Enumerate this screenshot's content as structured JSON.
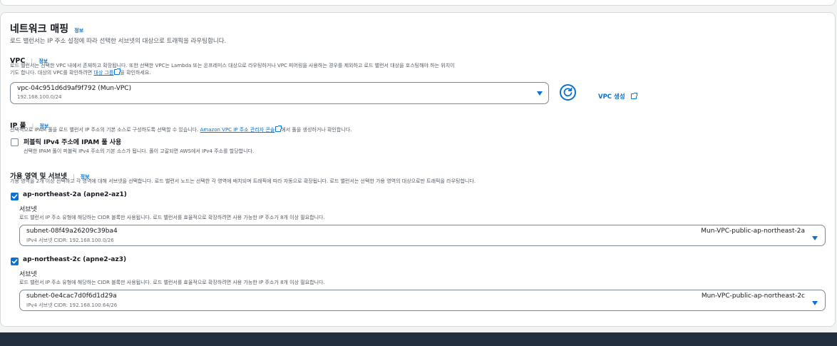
{
  "section": {
    "title": "네트워크 매핑",
    "info": "정보",
    "description": "로드 밸런서는 IP 주소 설정에 따라 선택한 서브넷의 대상으로 트래픽을 라우팅합니다."
  },
  "vpc": {
    "label": "VPC",
    "info": "정보",
    "desc_line1": "로드 밸런서는 선택한 VPC 내에서 존재하고 확장됩니다. 또한 선택한 VPC는 Lambda 또는 온프레미스 대상으로 라우팅하거나 VPC 피어링을 사용하는 경우를 제외하고 로드 밸런서 대상을 호스팅해야 하는 위치이",
    "desc_line2_pre": "기도 합니다. 대상의 VPC를 확인하려면",
    "desc_link": "대상 그룹",
    "desc_line2_post": "을 확인하세요.",
    "selected_id": "vpc-04c951d6d9af9f792 (Mun-VPC)",
    "selected_cidr": "192.168.100.0/24",
    "create_link": "VPC 생성"
  },
  "ip_pool": {
    "label": "IP 풀",
    "info": "정보",
    "desc_pre": "선택적으로 IPAM 풀을 로드 밸런서 IP 주소의 기본 소스로 구성하도록 선택할 수 있습니다.",
    "desc_link": "Amazon VPC IP 주소 관리자 콘솔",
    "desc_post": "에서 풀을 생성하거나 확인합니다.",
    "checkbox_label": "퍼블릭 IPv4 주소에 IPAM 풀 사용",
    "checkbox_desc": "선택한 IPAM 풀이 퍼블릭 IPv4 주소의 기본 소스가 됩니다. 풀이 고갈되면 AWS에서 IPv4 주소를 할당합니다."
  },
  "az": {
    "label": "가용 영역 및 서브넷",
    "info": "정보",
    "description": "가용 영역을 2개 이상 선택하고 각 영역에 대해 서브넷을 선택합니다. 로드 밸런서 노드는 선택한 각 영역에 배치되며 트래픽에 따라 자동으로 확장됩니다. 로드 밸런서는 선택한 가용 영역의 대상으로만 트래픽을 라우팅합니다.",
    "zones": [
      {
        "name": "ap-northeast-2a (apne2-az1)",
        "subnet_label": "서브넷",
        "subnet_desc": "로드 밸런서 IP 주소 유형에 해당하는 CIDR 블록만 사용됩니다. 로드 밸런서를 효율적으로 확장하려면 사용 가능한 IP 주소가 8개 이상 필요합니다.",
        "subnet_id": "subnet-08f49a26209c39ba4",
        "subnet_cidr": "IPv4 서브넷 CIDR: 192.168.100.0/26",
        "subnet_name": "Mun-VPC-public-ap-northeast-2a"
      },
      {
        "name": "ap-northeast-2c (apne2-az3)",
        "subnet_label": "서브넷",
        "subnet_desc": "로드 밸런서 IP 주소 유형에 해당하는 CIDR 블록만 사용됩니다. 로드 밸런서를 효율적으로 확장하려면 사용 가능한 IP 주소가 8개 이상 필요합니다.",
        "subnet_id": "subnet-0e4cac7d0f6d1d29a",
        "subnet_cidr": "IPv4 서브넷 CIDR: 192.168.100.64/26",
        "subnet_name": "Mun-VPC-public-ap-northeast-2c"
      }
    ]
  },
  "colors": {
    "accent": "#0972d3",
    "text": "#16191f",
    "muted": "#545b64",
    "footer": "#232f3e"
  }
}
